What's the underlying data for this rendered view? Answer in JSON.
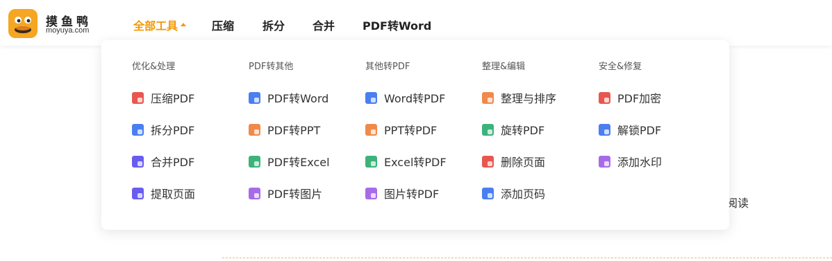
{
  "brand": {
    "name_cn": "摸鱼鸭",
    "name_en": "moyuya.com"
  },
  "nav": [
    {
      "label": "全部工具",
      "active": true
    },
    {
      "label": "压缩"
    },
    {
      "label": "拆分"
    },
    {
      "label": "合并"
    },
    {
      "label": "PDF转Word"
    }
  ],
  "colors": {
    "accent": "#f39800"
  },
  "menu": {
    "columns": [
      {
        "title": "优化&处理",
        "items": [
          {
            "label": "压缩PDF",
            "icon": "compress-icon",
            "color": "#e8574f"
          },
          {
            "label": "拆分PDF",
            "icon": "split-icon",
            "color": "#4a7ff0"
          },
          {
            "label": "合并PDF",
            "icon": "merge-icon",
            "color": "#6a5cf0"
          },
          {
            "label": "提取页面",
            "icon": "extract-icon",
            "color": "#6a5cf0"
          }
        ]
      },
      {
        "title": "PDF转其他",
        "items": [
          {
            "label": "PDF转Word",
            "icon": "pdf-word-icon",
            "color": "#4a7ff0"
          },
          {
            "label": "PDF转PPT",
            "icon": "pdf-ppt-icon",
            "color": "#f08a4b"
          },
          {
            "label": "PDF转Excel",
            "icon": "pdf-excel-icon",
            "color": "#3db37a"
          },
          {
            "label": "PDF转图片",
            "icon": "pdf-image-icon",
            "color": "#a86be8"
          }
        ]
      },
      {
        "title": "其他转PDF",
        "items": [
          {
            "label": "Word转PDF",
            "icon": "word-pdf-icon",
            "color": "#4a7ff0"
          },
          {
            "label": "PPT转PDF",
            "icon": "ppt-pdf-icon",
            "color": "#f08a4b"
          },
          {
            "label": "Excel转PDF",
            "icon": "excel-pdf-icon",
            "color": "#3db37a"
          },
          {
            "label": "图片转PDF",
            "icon": "image-pdf-icon",
            "color": "#a86be8"
          }
        ]
      },
      {
        "title": "整理&编辑",
        "items": [
          {
            "label": "整理与排序",
            "icon": "organize-icon",
            "color": "#f08a4b"
          },
          {
            "label": "旋转PDF",
            "icon": "rotate-icon",
            "color": "#3db37a"
          },
          {
            "label": "删除页面",
            "icon": "delete-page-icon",
            "color": "#e8574f"
          },
          {
            "label": "添加页码",
            "icon": "page-number-icon",
            "color": "#4a7ff0"
          }
        ]
      },
      {
        "title": "安全&修复",
        "items": [
          {
            "label": "PDF加密",
            "icon": "lock-icon",
            "color": "#e8574f"
          },
          {
            "label": "解锁PDF",
            "icon": "unlock-icon",
            "color": "#4a7ff0"
          },
          {
            "label": "添加水印",
            "icon": "watermark-icon",
            "color": "#a86be8"
          }
        ]
      }
    ]
  },
  "background": {
    "partial_text": "阅读"
  }
}
